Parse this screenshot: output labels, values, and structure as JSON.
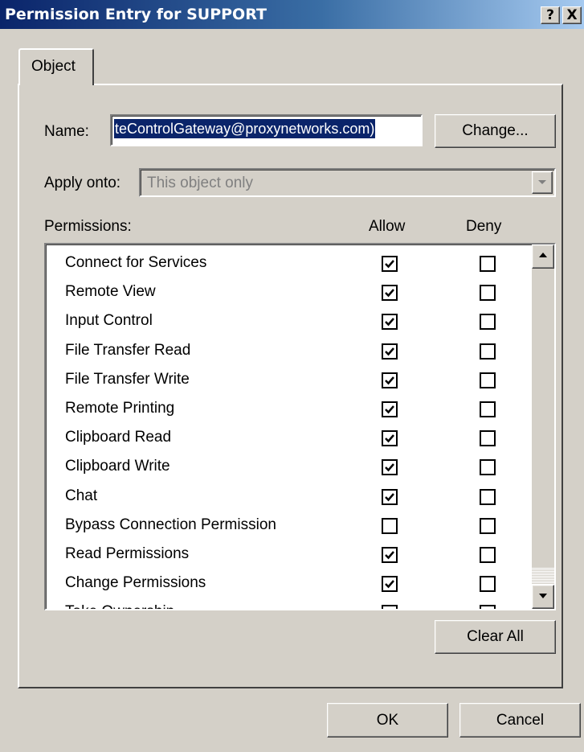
{
  "window": {
    "title": "Permission Entry for SUPPORT",
    "help_button": "?",
    "close_button": "X"
  },
  "tab": {
    "label": "Object"
  },
  "name": {
    "label": "Name:",
    "value": "teControlGateway@proxynetworks.com)",
    "change_button": "Change..."
  },
  "apply_onto": {
    "label": "Apply onto:",
    "value": "This object only"
  },
  "permissions": {
    "label": "Permissions:",
    "allow_header": "Allow",
    "deny_header": "Deny",
    "rows": [
      {
        "name": "Connect for Services",
        "allow": true,
        "deny": false
      },
      {
        "name": "Remote View",
        "allow": true,
        "deny": false
      },
      {
        "name": "Input Control",
        "allow": true,
        "deny": false
      },
      {
        "name": "File Transfer Read",
        "allow": true,
        "deny": false
      },
      {
        "name": "File Transfer Write",
        "allow": true,
        "deny": false
      },
      {
        "name": "Remote Printing",
        "allow": true,
        "deny": false
      },
      {
        "name": "Clipboard Read",
        "allow": true,
        "deny": false
      },
      {
        "name": "Clipboard Write",
        "allow": true,
        "deny": false
      },
      {
        "name": "Chat",
        "allow": true,
        "deny": false
      },
      {
        "name": "Bypass Connection Permission",
        "allow": false,
        "deny": false
      },
      {
        "name": "Read Permissions",
        "allow": true,
        "deny": false
      },
      {
        "name": "Change Permissions",
        "allow": true,
        "deny": false
      },
      {
        "name": "Take Ownership",
        "allow": true,
        "deny": false
      }
    ],
    "clear_all_button": "Clear All"
  },
  "footer": {
    "ok_button": "OK",
    "cancel_button": "Cancel"
  }
}
